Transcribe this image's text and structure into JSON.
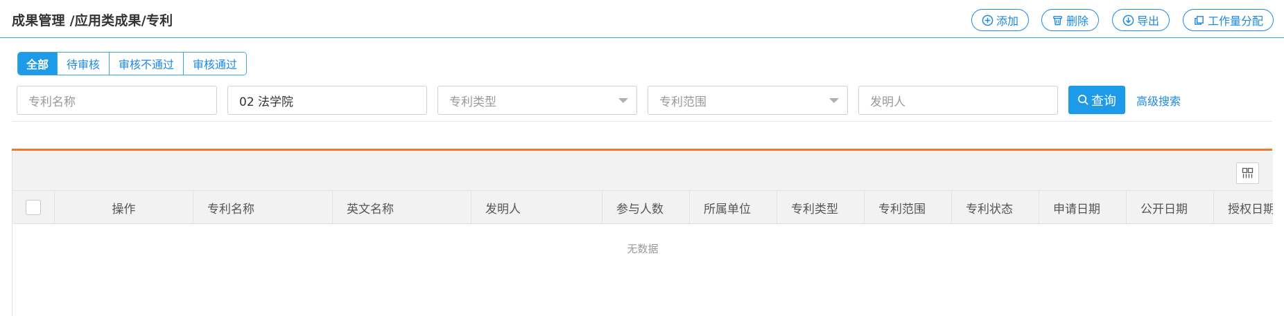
{
  "header": {
    "title": "成果管理 /应用类成果/专利",
    "buttons": {
      "add": "添加",
      "delete": "删除",
      "export": "导出",
      "workload": "工作量分配"
    }
  },
  "tabs": [
    {
      "label": "全部",
      "active": true
    },
    {
      "label": "待审核",
      "active": false
    },
    {
      "label": "审核不通过",
      "active": false
    },
    {
      "label": "审核通过",
      "active": false
    }
  ],
  "search": {
    "patent_name_placeholder": "专利名称",
    "college_value": "02 法学院",
    "patent_type_placeholder": "专利类型",
    "patent_scope_placeholder": "专利范围",
    "inventor_placeholder": "发明人",
    "query_label": "查询",
    "advanced_label": "高级搜索"
  },
  "table": {
    "columns": [
      "操作",
      "专利名称",
      "英文名称",
      "发明人",
      "参与人数",
      "所属单位",
      "专利类型",
      "专利范围",
      "专利状态",
      "申请日期",
      "公开日期",
      "授权日期"
    ],
    "empty_text": "无数据"
  },
  "colors": {
    "accent": "#1e9be8",
    "accent_border": "#3ba5e0",
    "divider_orange": "#f07a2a"
  }
}
